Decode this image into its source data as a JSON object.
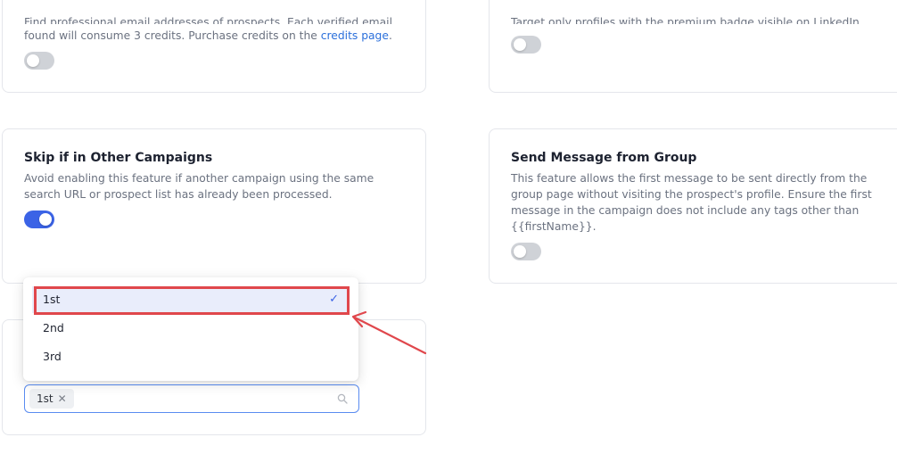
{
  "cards": {
    "email": {
      "desc_line1": "Find professional email addresses of prospects. Each verified email",
      "desc_line2_prefix": "found will consume 3 credits. Purchase credits on the ",
      "desc_link": "credits page",
      "desc_line2_suffix": "."
    },
    "premium": {
      "desc_line1": "Target only profiles with the premium badge visible on LinkedIn."
    },
    "skip": {
      "title": "Skip if in Other Campaigns",
      "desc_line1": "Avoid enabling this feature if another campaign using the same",
      "desc_line2": "search URL or prospect list has already been processed."
    },
    "group": {
      "title": "Send Message from Group",
      "desc_line1": "This feature allows the first message to be sent directly from the",
      "desc_line2": "group page without visiting the prospect's profile. Ensure the first",
      "desc_line3": "message in the campaign does not include any tags other than",
      "desc_line4": "{{firstName}}."
    }
  },
  "dropdown": {
    "options": [
      "1st",
      "2nd",
      "3rd"
    ],
    "selected": "1st"
  },
  "select": {
    "tag": "1st"
  },
  "icons": {
    "check": "check-icon",
    "remove": "close-icon",
    "search": "search-icon"
  },
  "colors": {
    "toggle_on": "#3b63e6",
    "toggle_off": "#cfd2d7",
    "highlight": "#e0474c",
    "link": "#2a6fdb"
  }
}
